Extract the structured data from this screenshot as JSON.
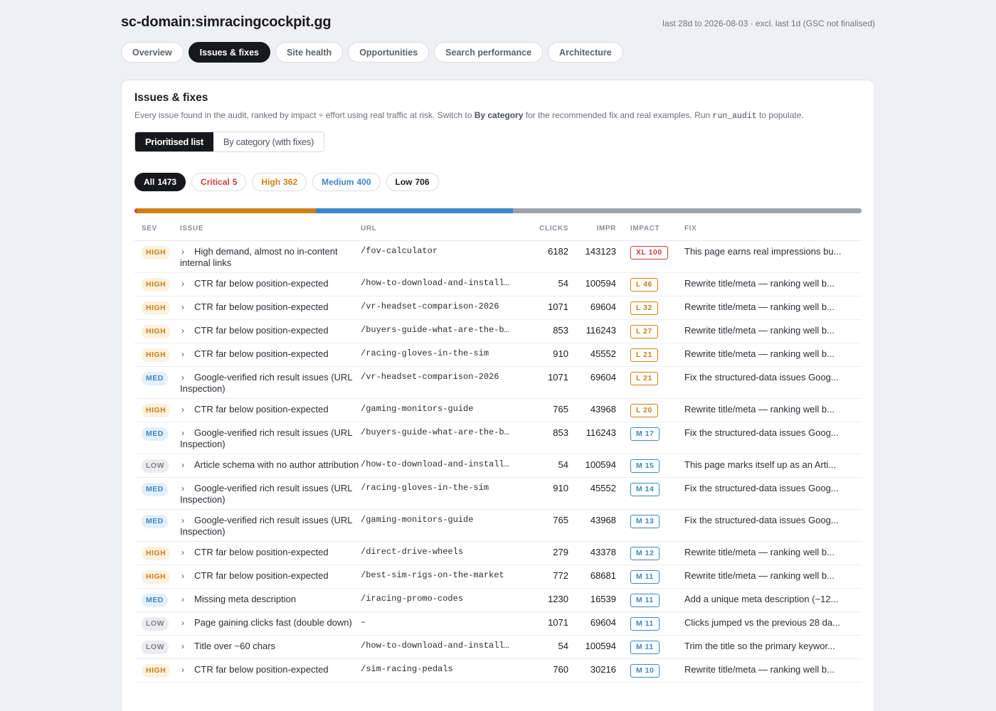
{
  "header": {
    "domain": "sc-domain:simracingcockpit.gg",
    "date_range": "last 28d to 2026-08-03 · excl. last 1d (GSC not finalised)"
  },
  "tabs": [
    {
      "label": "Overview",
      "active": false
    },
    {
      "label": "Issues & fixes",
      "active": true
    },
    {
      "label": "Site health",
      "active": false
    },
    {
      "label": "Opportunities",
      "active": false
    },
    {
      "label": "Search performance",
      "active": false
    },
    {
      "label": "Architecture",
      "active": false
    }
  ],
  "card": {
    "title": "Issues & fixes",
    "desc_1": "Every issue found in the audit, ranked by impact ÷ effort using real traffic at risk. Switch to ",
    "desc_bold": "By category",
    "desc_2": " for the recommended fix and real examples. Run ",
    "desc_code": "run_audit",
    "desc_3": " to populate."
  },
  "view_toggle": {
    "prioritised": "Prioritised list",
    "by_category": "By category (with fixes)"
  },
  "filters": {
    "all": {
      "label": "All",
      "count": "1473"
    },
    "critical": {
      "label": "Critical",
      "count": "5"
    },
    "high": {
      "label": "High",
      "count": "362"
    },
    "medium": {
      "label": "Medium",
      "count": "400"
    },
    "low": {
      "label": "Low",
      "count": "706"
    }
  },
  "severity_bar": {
    "total": 1473,
    "segments": [
      {
        "name": "critical",
        "count": 5,
        "color": "#d13b3b"
      },
      {
        "name": "high",
        "count": 362,
        "color": "#cf7f16"
      },
      {
        "name": "medium",
        "count": 400,
        "color": "#3b87c8"
      },
      {
        "name": "low",
        "count": 706,
        "color": "#9ea2aa"
      }
    ]
  },
  "columns": {
    "sev": "SEV",
    "issue": "ISSUE",
    "url": "URL",
    "clicks": "CLICKS",
    "impr": "IMPR",
    "impact": "IMPACT",
    "fix": "FIX"
  },
  "rows": [
    {
      "sev": "HIGH",
      "issue": "High demand, almost no in-content internal links",
      "url": "/fov-calculator",
      "clicks": "6182",
      "impr": "143123",
      "impact_size": "XL",
      "impact": "XL 100",
      "fix": "This page earns real impressions bu..."
    },
    {
      "sev": "HIGH",
      "issue": "CTR far below position-expected",
      "url": "/how-to-download-and-install-…",
      "clicks": "54",
      "impr": "100594",
      "impact_size": "L",
      "impact": "L 46",
      "fix": "Rewrite title/meta — ranking well b..."
    },
    {
      "sev": "HIGH",
      "issue": "CTR far below position-expected",
      "url": "/vr-headset-comparison-2026",
      "clicks": "1071",
      "impr": "69604",
      "impact_size": "L",
      "impact": "L 32",
      "fix": "Rewrite title/meta — ranking well b..."
    },
    {
      "sev": "HIGH",
      "issue": "CTR far below position-expected",
      "url": "/buyers-guide-what-are-the-be…",
      "clicks": "853",
      "impr": "116243",
      "impact_size": "L",
      "impact": "L 27",
      "fix": "Rewrite title/meta — ranking well b..."
    },
    {
      "sev": "HIGH",
      "issue": "CTR far below position-expected",
      "url": "/racing-gloves-in-the-sim",
      "clicks": "910",
      "impr": "45552",
      "impact_size": "L",
      "impact": "L 21",
      "fix": "Rewrite title/meta — ranking well b..."
    },
    {
      "sev": "MED",
      "issue": "Google-verified rich result issues (URL Inspection)",
      "url": "/vr-headset-comparison-2026",
      "clicks": "1071",
      "impr": "69604",
      "impact_size": "L",
      "impact": "L 21",
      "fix": "Fix the structured-data issues Goog..."
    },
    {
      "sev": "HIGH",
      "issue": "CTR far below position-expected",
      "url": "/gaming-monitors-guide",
      "clicks": "765",
      "impr": "43968",
      "impact_size": "L",
      "impact": "L 20",
      "fix": "Rewrite title/meta — ranking well b..."
    },
    {
      "sev": "MED",
      "issue": "Google-verified rich result issues (URL Inspection)",
      "url": "/buyers-guide-what-are-the-be…",
      "clicks": "853",
      "impr": "116243",
      "impact_size": "M",
      "impact": "M 17",
      "fix": "Fix the structured-data issues Goog..."
    },
    {
      "sev": "LOW",
      "issue": "Article schema with no author attribution",
      "url": "/how-to-download-and-install-…",
      "clicks": "54",
      "impr": "100594",
      "impact_size": "M",
      "impact": "M 15",
      "fix": "This page marks itself up as an Arti..."
    },
    {
      "sev": "MED",
      "issue": "Google-verified rich result issues (URL Inspection)",
      "url": "/racing-gloves-in-the-sim",
      "clicks": "910",
      "impr": "45552",
      "impact_size": "M",
      "impact": "M 14",
      "fix": "Fix the structured-data issues Goog..."
    },
    {
      "sev": "MED",
      "issue": "Google-verified rich result issues (URL Inspection)",
      "url": "/gaming-monitors-guide",
      "clicks": "765",
      "impr": "43968",
      "impact_size": "M",
      "impact": "M 13",
      "fix": "Fix the structured-data issues Goog..."
    },
    {
      "sev": "HIGH",
      "issue": "CTR far below position-expected",
      "url": "/direct-drive-wheels",
      "clicks": "279",
      "impr": "43378",
      "impact_size": "M",
      "impact": "M 12",
      "fix": "Rewrite title/meta — ranking well b..."
    },
    {
      "sev": "HIGH",
      "issue": "CTR far below position-expected",
      "url": "/best-sim-rigs-on-the-market",
      "clicks": "772",
      "impr": "68681",
      "impact_size": "M",
      "impact": "M 11",
      "fix": "Rewrite title/meta — ranking well b..."
    },
    {
      "sev": "MED",
      "issue": "Missing meta description",
      "url": "/iracing-promo-codes",
      "clicks": "1230",
      "impr": "16539",
      "impact_size": "M",
      "impact": "M 11",
      "fix": "Add a unique meta description (~12..."
    },
    {
      "sev": "LOW",
      "issue": "Page gaining clicks fast (double down)",
      "url": "–",
      "clicks": "1071",
      "impr": "69604",
      "impact_size": "M",
      "impact": "M 11",
      "fix": "Clicks jumped vs the previous 28 da..."
    },
    {
      "sev": "LOW",
      "issue": "Title over ~60 chars",
      "url": "/how-to-download-and-install-…",
      "clicks": "54",
      "impr": "100594",
      "impact_size": "M",
      "impact": "M 11",
      "fix": "Trim the title so the primary keywor..."
    },
    {
      "sev": "HIGH",
      "issue": "CTR far below position-expected",
      "url": "/sim-racing-pedals",
      "clicks": "760",
      "impr": "30216",
      "impact_size": "M",
      "impact": "M 10",
      "fix": "Rewrite title/meta — ranking well b..."
    }
  ]
}
